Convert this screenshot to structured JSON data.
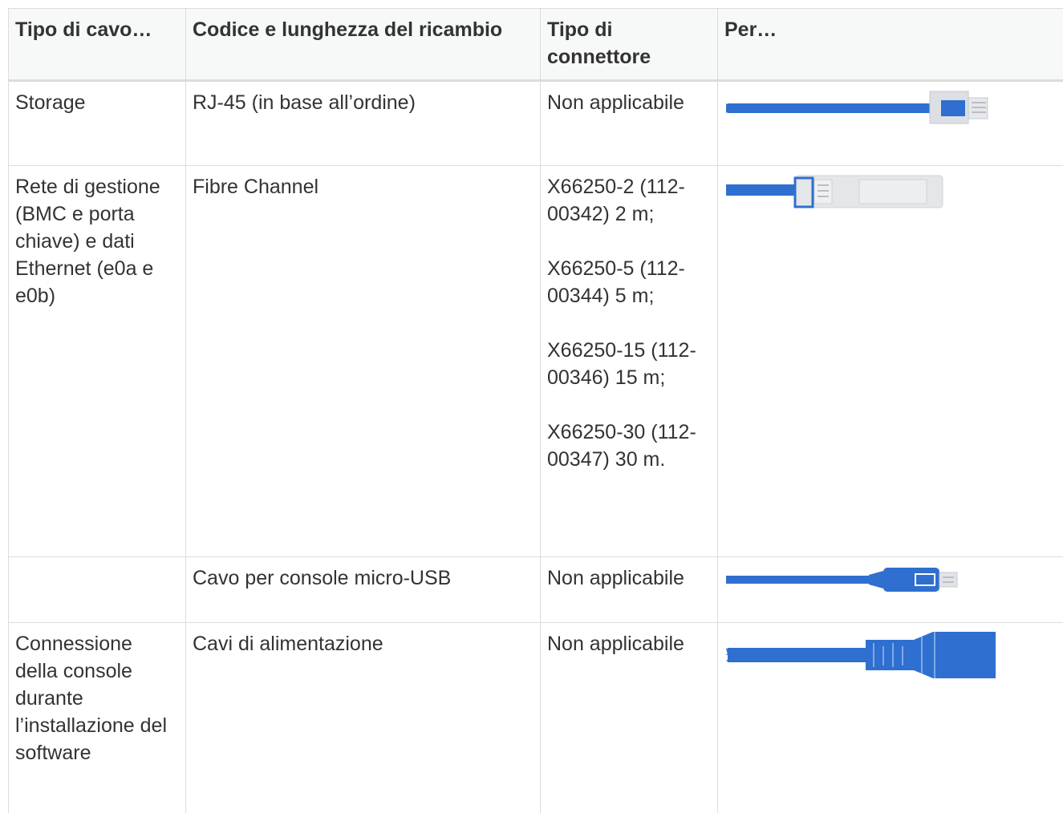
{
  "table": {
    "headers": [
      "Tipo di cavo…",
      "Codice e lunghezza del ricambio",
      "Tipo di connettore",
      "Per…"
    ],
    "rows": [
      {
        "cable_type": "Storage",
        "part": "RJ-45 (in base all’ordine)",
        "connector": [
          "Non applicabile"
        ],
        "image": "rj45-cable-icon"
      },
      {
        "cable_type": "Rete di gestione (BMC e porta chiave) e dati Ethernet (e0a e e0b)",
        "part": "Fibre Channel",
        "connector": [
          "X66250-2 (112-00342) 2 m;",
          "X66250-5 (112-00344) 5 m;",
          "X66250-15 (112-00346) 15 m;",
          "X66250-30 (112-00347) 30 m."
        ],
        "image": "fibre-channel-cable-icon"
      },
      {
        "cable_type": "",
        "part": "Cavo per console micro-USB",
        "connector": [
          "Non applicabile"
        ],
        "image": "micro-usb-cable-icon"
      },
      {
        "cable_type": "Connessione della console durante l’installazione del software",
        "part": "Cavi di alimentazione",
        "connector": [
          "Non applicabile"
        ],
        "image": "power-cable-icon"
      }
    ]
  },
  "colors": {
    "cable_blue": "#2f6fcf",
    "connector_gray": "#dcdfe3",
    "header_bg": "#f7f8f8",
    "border": "#dcdcdc",
    "text": "#333333"
  }
}
